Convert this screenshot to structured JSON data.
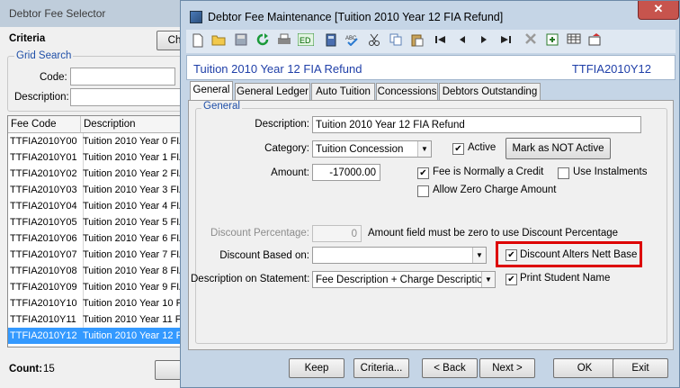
{
  "background_window": {
    "title": "Debtor Fee Selector",
    "criteria_label": "Criteria",
    "criteria_button": "Ch",
    "grid_search_label": "Grid Search",
    "code_label": "Code:",
    "description_label": "Description:",
    "columns": [
      "Fee Code",
      "Description"
    ],
    "rows": [
      {
        "code": "TTFIA2010Y00",
        "desc": "Tuition 2010 Year 0 FIA"
      },
      {
        "code": "TTFIA2010Y01",
        "desc": "Tuition 2010 Year 1 FIA"
      },
      {
        "code": "TTFIA2010Y02",
        "desc": "Tuition 2010 Year 2 FIA"
      },
      {
        "code": "TTFIA2010Y03",
        "desc": "Tuition 2010 Year 3 FIA"
      },
      {
        "code": "TTFIA2010Y04",
        "desc": "Tuition 2010 Year 4 FIA"
      },
      {
        "code": "TTFIA2010Y05",
        "desc": "Tuition 2010 Year 5 FIA"
      },
      {
        "code": "TTFIA2010Y06",
        "desc": "Tuition 2010 Year 6 FIA"
      },
      {
        "code": "TTFIA2010Y07",
        "desc": "Tuition 2010 Year 7 FIA"
      },
      {
        "code": "TTFIA2010Y08",
        "desc": "Tuition 2010 Year 8 FIA"
      },
      {
        "code": "TTFIA2010Y09",
        "desc": "Tuition 2010 Year 9 FIA"
      },
      {
        "code": "TTFIA2010Y10",
        "desc": "Tuition 2010 Year 10 FI"
      },
      {
        "code": "TTFIA2010Y11",
        "desc": "Tuition 2010 Year 11 FI"
      },
      {
        "code": "TTFIA2010Y12",
        "desc": "Tuition 2010 Year 12 FIA"
      }
    ],
    "selected_row": "TTFIA2010Y12",
    "count_label": "Count:",
    "count_value": "15"
  },
  "dialog": {
    "title": "Debtor Fee Maintenance  [Tuition 2010 Year 12 FIA Refund]",
    "close_glyph": "✕",
    "header_name": "Tuition 2010 Year 12 FIA Refund",
    "header_code": "TTFIA2010Y12",
    "tabs": [
      "General",
      "General Ledger",
      "Auto Tuition",
      "Concessions",
      "Debtors Outstanding"
    ],
    "active_tab": "General",
    "group_label": "General",
    "description_label": "Description:",
    "description_value": "Tuition 2010 Year 12 FIA Refund",
    "category_label": "Category:",
    "category_value": "Tuition Concession",
    "active_label": "Active",
    "mark_not_active_button": "Mark as NOT Active",
    "amount_label": "Amount:",
    "amount_value": "-17000.00",
    "fee_credit_label": "Fee is Normally a Credit",
    "use_instalments_label": "Use Instalments",
    "allow_zero_label": "Allow Zero Charge Amount",
    "discount_pct_label": "Discount Percentage:",
    "discount_pct_value": "0",
    "discount_pct_note": "Amount field must be zero to use Discount Percentage",
    "discount_based_label": "Discount Based on:",
    "discount_based_value": "",
    "discount_alters_label": "Discount Alters Nett Base",
    "desc_statement_label": "Description on Statement:",
    "desc_statement_value": "Fee Description + Charge Description",
    "print_student_label": "Print Student Name",
    "checkboxes": {
      "active": true,
      "fee_credit": true,
      "use_instalments": false,
      "allow_zero": false,
      "discount_alters": true,
      "print_student": true
    },
    "buttons": {
      "keep": "Keep",
      "criteria": "Criteria...",
      "back": "< Back",
      "next": "Next >",
      "ok": "OK",
      "exit": "Exit"
    },
    "highlight_color": "#dd0000",
    "header_text_color": "#1f3fa8"
  }
}
